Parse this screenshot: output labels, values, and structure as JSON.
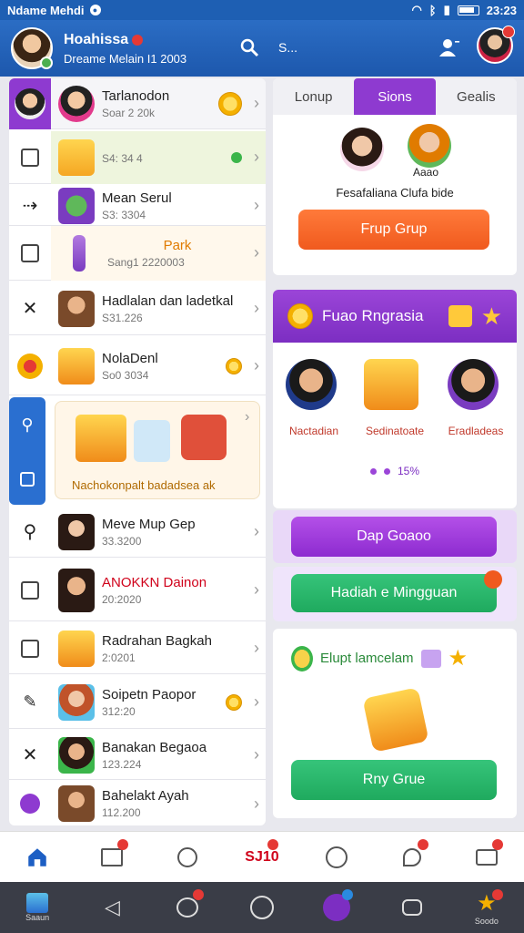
{
  "statusbar": {
    "title": "Ndame Mehdi",
    "time": "23:23"
  },
  "header": {
    "name": "Hoahissa",
    "subtitle": "Dreame Melain I1 2003",
    "search_label": "S..."
  },
  "list": [
    {
      "title": "Tarlanodon",
      "sub": "Soar 2 20k"
    },
    {
      "title": "",
      "sub": "S4: 34 4"
    },
    {
      "title": "Mean Serul",
      "sub": "S3: 3304"
    },
    {
      "title": "Park",
      "sub": "Sang1  2220003"
    },
    {
      "title": "Hadlalan dan ladetkal",
      "sub": "S31.226"
    },
    {
      "title": "NolaDenl",
      "sub": "So0 3034"
    },
    {
      "title": "",
      "sub": "Nachokonpalt badadsea ak"
    },
    {
      "title": "Meve Mup Gep",
      "sub": "33.3200"
    },
    {
      "title": "ANOKKN Dainon",
      "sub": "20:2020"
    },
    {
      "title": "Radrahan Bagkah",
      "sub": "2:0201"
    },
    {
      "title": "Soipetn Paopor",
      "sub": "312:20"
    },
    {
      "title": "Banakan Begaoa",
      "sub": "123.224"
    },
    {
      "title": "Bahelakt Ayah",
      "sub": "112.200"
    }
  ],
  "tabs": [
    "Lonup",
    "Sions",
    "Gealis"
  ],
  "card1": {
    "caption": "Fesafaliana Clufa bide",
    "button": "Frup Grup",
    "char_label": "Aaao"
  },
  "card2": {
    "title": "Fuao Rngrasia",
    "chars": [
      "Nactadian",
      "Sedinatoate",
      "Eradladeas"
    ],
    "progress": "15%"
  },
  "buttons": {
    "purple": "Dap Goaoo",
    "green": "Hadiah e Mingguan"
  },
  "card3": {
    "title": "Elupt lamcelam",
    "button": "Rny Grue"
  },
  "bottomnav": {
    "center_label": "SJ10"
  },
  "sysbar": {
    "left_label": "Saaun",
    "right_label": "Soodo"
  }
}
